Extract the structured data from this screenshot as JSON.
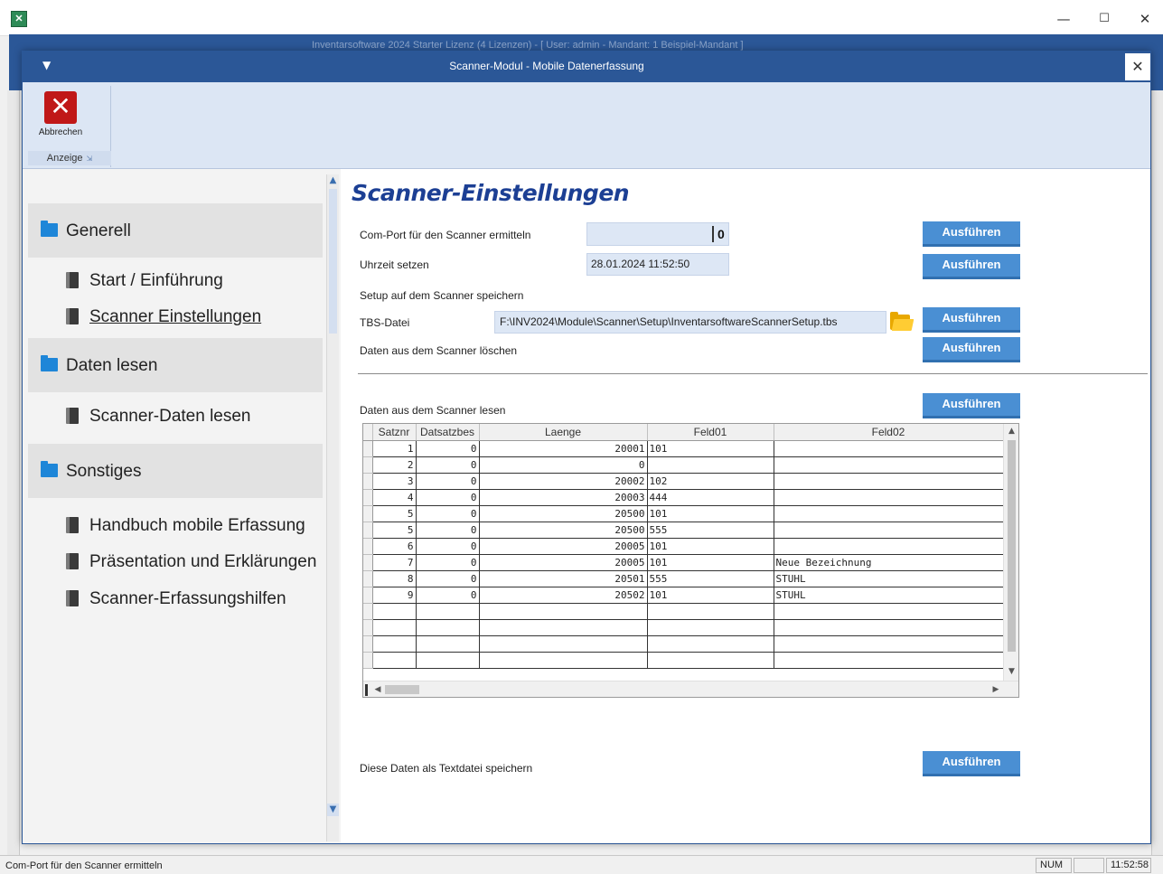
{
  "window": {
    "app_icon_glyph": "✕",
    "minimize_glyph": "—",
    "maximize_glyph": "☐",
    "close_glyph": "✕",
    "background_title": "Inventarsoftware 2024 Starter Lizenz (4 Lizenzen) - [ User: admin - Mandant: 1 Beispiel-Mandant ]"
  },
  "dialog": {
    "title": "Scanner-Modul - Mobile Datenerfassung",
    "quick_access_glyph": "▼",
    "close_glyph": "✕",
    "accent_color": "#2b5797"
  },
  "ribbon": {
    "abort_label": "Abbrechen",
    "abort_icon": "close-icon",
    "abort_glyph": "✕",
    "group_label": "Anzeige",
    "group_launcher_glyph": "⇲"
  },
  "nav": {
    "sections": [
      {
        "label": "Generell",
        "items": [
          "Start / Einführung",
          "Scanner Einstellungen"
        ]
      },
      {
        "label": "Daten lesen",
        "items": [
          "Scanner-Daten lesen"
        ]
      },
      {
        "label": "Sonstiges",
        "items": [
          "Handbuch mobile Erfassung",
          "Präsentation und Erklärungen",
          "Scanner-Erfassungshilfen"
        ]
      }
    ],
    "scroll_up_glyph": "▲",
    "scroll_down_glyph": "▼"
  },
  "main": {
    "title": "Scanner-Einstellungen",
    "title_color": "#1c3f94",
    "com_port_label": "Com-Port für den Scanner ermitteln",
    "com_port_value": "0",
    "time_label": "Uhrzeit setzen",
    "time_value": "28.01.2024 11:52:50",
    "setup_label": "Setup auf dem Scanner speichern",
    "tbs_label": "TBS-Datei",
    "tbs_value": "F:\\INV2024\\Module\\Scanner\\Setup\\InventarsoftwareScannerSetup.tbs",
    "delete_label": "Daten aus dem Scanner löschen",
    "read_label": "Daten aus dem Scanner lesen",
    "save_label": "Diese Daten als Textdatei speichern",
    "execute_label": "Ausführen",
    "button_color": "#4a8fd3"
  },
  "grid": {
    "columns": [
      "",
      "Satznr",
      "Datsatzbes",
      "Laenge",
      "Feld01",
      "Feld02"
    ],
    "rows": [
      [
        "1",
        "0",
        "20001",
        "101",
        ""
      ],
      [
        "2",
        "0",
        "0",
        "",
        ""
      ],
      [
        "3",
        "0",
        "20002",
        "102",
        ""
      ],
      [
        "4",
        "0",
        "20003",
        "444",
        ""
      ],
      [
        "5",
        "0",
        "20500",
        "101",
        ""
      ],
      [
        "5",
        "0",
        "20500",
        "555",
        ""
      ],
      [
        "6",
        "0",
        "20005",
        "101",
        ""
      ],
      [
        "7",
        "0",
        "20005",
        "101",
        "Neue Bezeichnung"
      ],
      [
        "8",
        "0",
        "20501",
        "555",
        "STUHL"
      ],
      [
        "9",
        "0",
        "20502",
        "101",
        "STUHL"
      ],
      [
        "",
        "",
        "",
        "",
        ""
      ],
      [
        "",
        "",
        "",
        "",
        ""
      ],
      [
        "",
        "",
        "",
        "",
        ""
      ],
      [
        "",
        "",
        "",
        "",
        ""
      ]
    ],
    "scroll_up_glyph": "▲",
    "scroll_down_glyph": "▼",
    "scroll_left_glyph": "◀",
    "scroll_right_glyph": "▶"
  },
  "status": {
    "text": "Com-Port für den Scanner ermitteln",
    "num": "NUM",
    "time": "11:52:58"
  }
}
